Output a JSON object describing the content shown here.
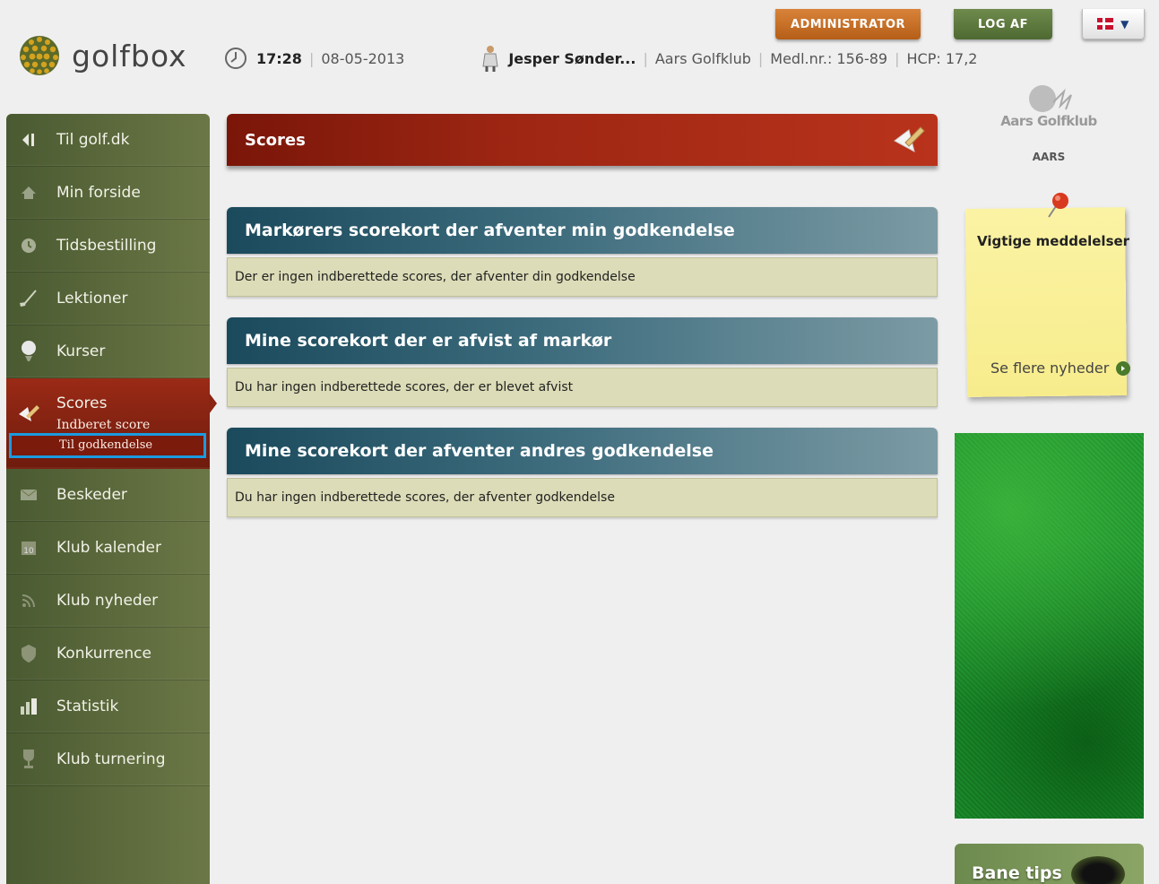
{
  "header": {
    "logo_text": "golfbox",
    "time": "17:28",
    "date": "08-05-2013",
    "user_name": "Jesper Sønder...",
    "club": "Aars Golfklub",
    "member_no": "Medl.nr.: 156-89",
    "hcp": "HCP: 17,2",
    "admin_button": "ADMINISTRATOR",
    "logout_button": "LOG AF",
    "language_flag": "danish-flag-icon"
  },
  "sidebar": {
    "items": [
      {
        "label": "Til golf.dk",
        "icon": "back-arrow-icon"
      },
      {
        "label": "Min forside",
        "icon": "home-icon"
      },
      {
        "label": "Tidsbestilling",
        "icon": "clock-icon"
      },
      {
        "label": "Lektioner",
        "icon": "golf-club-icon"
      },
      {
        "label": "Kurser",
        "icon": "golf-ball-tee-icon"
      },
      {
        "label": "Scores",
        "icon": "pencil-scorecard-icon",
        "active": true
      },
      {
        "label": "Beskeder",
        "icon": "envelope-icon"
      },
      {
        "label": "Klub kalender",
        "icon": "calendar-icon"
      },
      {
        "label": "Klub nyheder",
        "icon": "rss-icon"
      },
      {
        "label": "Konkurrence",
        "icon": "shield-icon"
      },
      {
        "label": "Statistik",
        "icon": "bar-chart-icon"
      },
      {
        "label": "Klub turnering",
        "icon": "trophy-icon"
      }
    ],
    "scores_sub": {
      "item1": "Indberet score",
      "item2": "Til godkendelse"
    }
  },
  "main": {
    "page_title": "Scores",
    "sections": [
      {
        "heading": "Markørers scorekort der afventer min godkendelse",
        "message": "Der er ingen indberettede scores, der afventer din godkendelse"
      },
      {
        "heading": "Mine scorekort der er afvist af markør",
        "message": "Du har ingen indberettede scores, der er blevet afvist"
      },
      {
        "heading": "Mine scorekort der afventer andres godkendelse",
        "message": "Du har ingen indberettede scores, der afventer godkendelse"
      }
    ]
  },
  "right": {
    "club_logo_text": "Aars Golfklub",
    "club_caption": "AARS",
    "note_title": "Vigtige meddelelser",
    "note_link": "Se flere nyheder",
    "bane_tips": "Bane tips"
  },
  "colors": {
    "sidebar": "#5a6a3a",
    "active_nav": "#8a2413",
    "title_bar": "#9d2613",
    "section_head": "#2a5a6c",
    "section_body": "#dcdcb8",
    "admin": "#c8712a",
    "logout": "#5e7a3f",
    "highlight": "#1a9be0"
  }
}
